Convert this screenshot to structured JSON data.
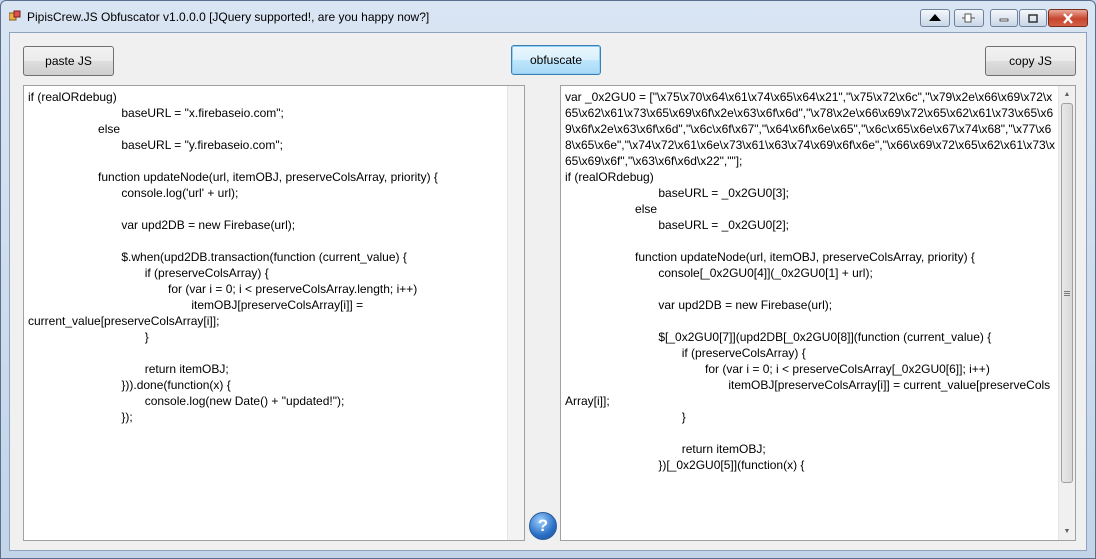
{
  "window": {
    "title": "PipisCrew.JS Obfuscator v1.0.0.0  [JQuery supported!, are you happy now?]"
  },
  "icons": {
    "app": "app-icon",
    "help": "help-icon",
    "caption_up": "triangle-up-icon",
    "caption_pin": "pin-icon",
    "minimize": "minimize-icon",
    "maximize": "maximize-icon",
    "close": "close-icon"
  },
  "toolbar": {
    "paste_label": "paste JS",
    "obfuscate_label": "obfuscate",
    "copy_label": "copy JS"
  },
  "help": {
    "label": "?"
  },
  "input": {
    "text": "if (realORdebug)\n\t\t\t\tbaseURL = \"x.firebaseio.com\";\n\t\t\telse\n\t\t\t\tbaseURL = \"y.firebaseio.com\";\n\n\t\t\tfunction updateNode(url, itemOBJ, preserveColsArray, priority) {\n\t\t\t\tconsole.log('url' + url);\n\n\t\t\t\tvar upd2DB = new Firebase(url);\n\n\t\t\t\t$.when(upd2DB.transaction(function (current_value) {\n\t\t\t\t\tif (preserveColsArray) {\n\t\t\t\t\t\tfor (var i = 0; i < preserveColsArray.length; i++)\n\t\t\t\t\t\t\titemOBJ[preserveColsArray[i]] = current_value[preserveColsArray[i]];\n\t\t\t\t\t}\n\n\t\t\t\t\treturn itemOBJ;\n\t\t\t\t})).done(function(x) {\n\t\t\t\t\tconsole.log(new Date() + \"updated!\");\n\t\t\t\t});"
  },
  "output": {
    "text": "var _0x2GU0 = [\"\\x75\\x70\\x64\\x61\\x74\\x65\\x64\\x21\",\"\\x75\\x72\\x6c\",\"\\x79\\x2e\\x66\\x69\\x72\\x65\\x62\\x61\\x73\\x65\\x69\\x6f\\x2e\\x63\\x6f\\x6d\",\"\\x78\\x2e\\x66\\x69\\x72\\x65\\x62\\x61\\x73\\x65\\x69\\x6f\\x2e\\x63\\x6f\\x6d\",\"\\x6c\\x6f\\x67\",\"\\x64\\x6f\\x6e\\x65\",\"\\x6c\\x65\\x6e\\x67\\x74\\x68\",\"\\x77\\x68\\x65\\x6e\",\"\\x74\\x72\\x61\\x6e\\x73\\x61\\x63\\x74\\x69\\x6f\\x6e\",\"\\x66\\x69\\x72\\x65\\x62\\x61\\x73\\x65\\x69\\x6f\",\"\\x63\\x6f\\x6d\\x22\",\"\"];\nif (realORdebug)\n\t\t\t\tbaseURL = _0x2GU0[3];\n\t\t\telse\n\t\t\t\tbaseURL = _0x2GU0[2];\n\n\t\t\tfunction updateNode(url, itemOBJ, preserveColsArray, priority) {\n\t\t\t\tconsole[_0x2GU0[4]](_0x2GU0[1] + url);\n\n\t\t\t\tvar upd2DB = new Firebase(url);\n\n\t\t\t\t$[_0x2GU0[7]](upd2DB[_0x2GU0[8]](function (current_value) {\n\t\t\t\t\tif (preserveColsArray) {\n\t\t\t\t\t\tfor (var i = 0; i < preserveColsArray[_0x2GU0[6]]; i++)\n\t\t\t\t\t\t\titemOBJ[preserveColsArray[i]] = current_value[preserveColsArray[i]];\n\t\t\t\t\t}\n\n\t\t\t\t\treturn itemOBJ;\n\t\t\t\t})[_0x2GU0[5]](function(x) {"
  }
}
